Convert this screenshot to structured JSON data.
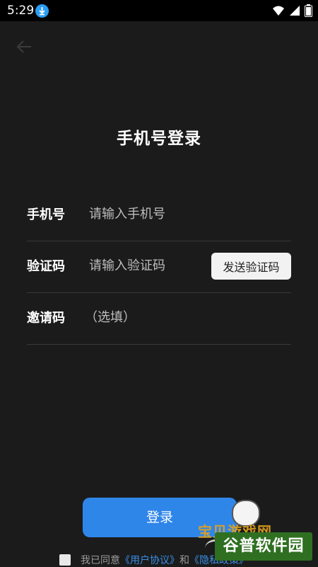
{
  "status_bar": {
    "time": "5:29"
  },
  "page": {
    "title": "手机号登录"
  },
  "form": {
    "phone": {
      "label": "手机号",
      "placeholder": "请输入手机号"
    },
    "code": {
      "label": "验证码",
      "placeholder": "请输入验证码",
      "send_button": "发送验证码"
    },
    "invite": {
      "label": "邀请码",
      "placeholder": "（选填）"
    }
  },
  "login_button": "登录",
  "agreement": {
    "prefix": "我已同意",
    "user_agreement": "《用户协议》",
    "conjunction": "和",
    "privacy_policy": "《隐私政策》"
  },
  "watermark": {
    "line1": "宝贝游戏网",
    "line2": "谷普软件园"
  },
  "colors": {
    "accent": "#2f86e9",
    "link": "#3a8fe6",
    "background": "#1b1b1b"
  }
}
